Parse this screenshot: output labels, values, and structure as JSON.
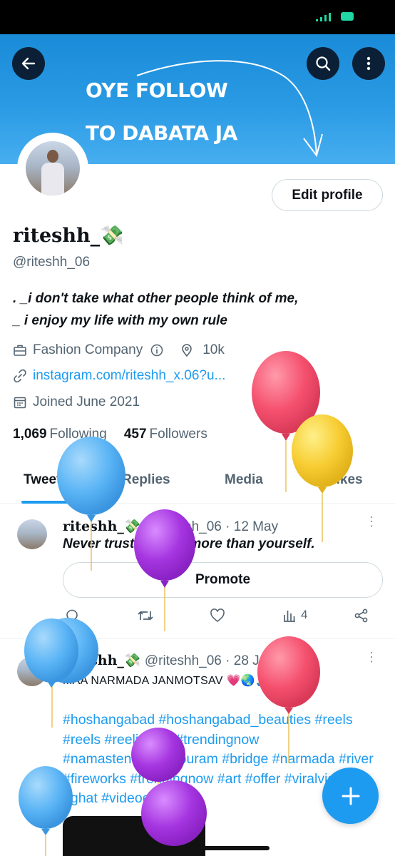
{
  "banner": {
    "line1": "OYE FOLLOW",
    "line2": "TO DABATA JA"
  },
  "profile": {
    "edit_label": "Edit profile",
    "name": "riteshh_💸",
    "handle": "@riteshh_06",
    "bio_line1": ". _i don't take what other people think of me,",
    "bio_line2": "_ i enjoy my life with my own rule",
    "category": "Fashion Company",
    "location": "10k",
    "link": "instagram.com/riteshh_x.06?u...",
    "joined": "Joined June 2021",
    "following_count": "1,069",
    "following_label": "Following",
    "followers_count": "457",
    "followers_label": "Followers"
  },
  "tabs": [
    "Tweets",
    "Replies",
    "Media",
    "Likes"
  ],
  "tweets": [
    {
      "name": "riteshh_💸",
      "handle_time": "@riteshh_06 · 12 May",
      "text": "Never trust anyone more than yourself.",
      "promote_label": "Promote",
      "views": "4"
    },
    {
      "name": "riteshh_💸",
      "handle_time": "@riteshh_06 · 28 Jan",
      "text": "MAA NARMADA JANMOTSAV 💗🌏🙏",
      "tags": "#hoshangabad #hoshangabad_beauties #reels #reels #reelitfeelit #trendingnow #namastenarmadapuram #bridge #narmada #river #fireworks #trendingnow #art #offer #viralvideos #ghat #videoediting"
    }
  ],
  "colors": {
    "accent": "#1d9bf0",
    "banner": "#1a8bd8",
    "balloon_blue": "#5ab4f5",
    "balloon_red": "#f5516f",
    "balloon_yellow": "#f7cd33",
    "balloon_purple": "#a535e0"
  },
  "icons": {
    "back": "arrow-left-icon",
    "search": "search-icon",
    "more": "more-vertical-icon",
    "compose": "plus-icon"
  }
}
